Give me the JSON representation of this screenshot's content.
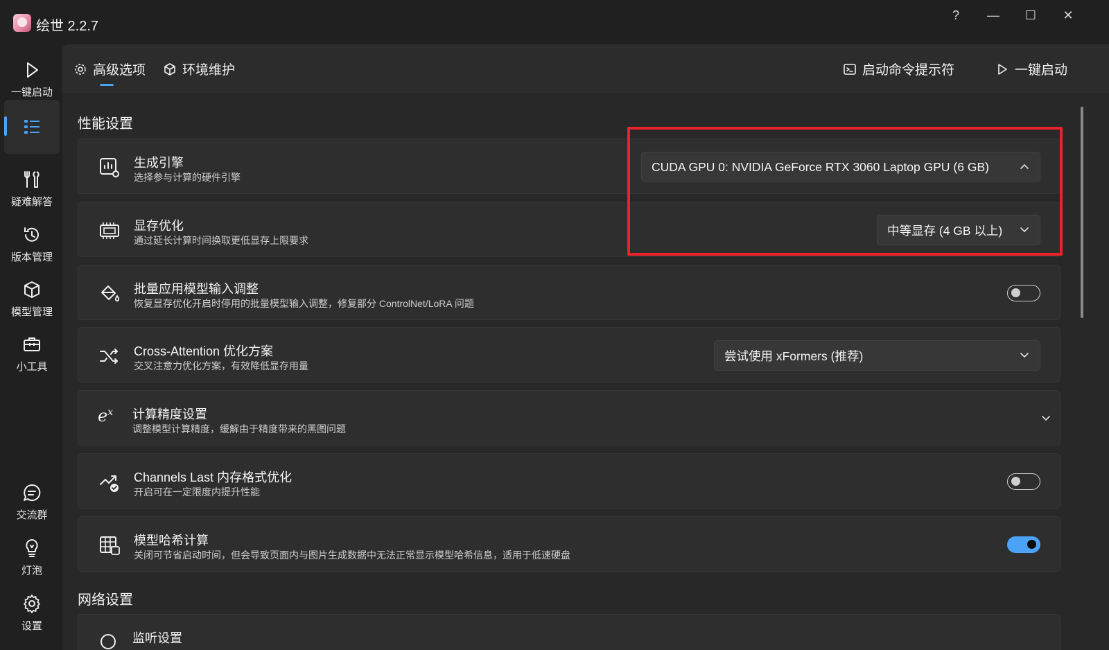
{
  "window": {
    "title": "绘世 2.2.7",
    "help_glyph": "?",
    "minimize_glyph": "—",
    "maximize_glyph": "☐",
    "close_glyph": "✕"
  },
  "nav": {
    "top": [
      {
        "label": "一键启动",
        "icon": "play-icon"
      },
      {
        "label": "",
        "icon": "list-icon"
      },
      {
        "label": "疑难解答",
        "icon": "tools-icon"
      },
      {
        "label": "版本管理",
        "icon": "history-icon"
      },
      {
        "label": "模型管理",
        "icon": "cube-icon"
      },
      {
        "label": "小工具",
        "icon": "toolbox-icon"
      }
    ],
    "bottom": [
      {
        "label": "交流群",
        "icon": "chat-icon"
      },
      {
        "label": "灯泡",
        "icon": "lightbulb-icon"
      },
      {
        "label": "设置",
        "icon": "gear-icon"
      }
    ],
    "accent": "#4aa3f5"
  },
  "tabs": {
    "advanced": "高级选项",
    "env": "环境维护",
    "cmd": "启动命令提示符",
    "launch": "一键启动"
  },
  "sections": {
    "performance": "性能设置",
    "network": "网络设置"
  },
  "settings": [
    {
      "title": "生成引擎",
      "desc": "选择参与计算的硬件引擎",
      "value": "CUDA GPU 0: NVIDIA GeForce RTX 3060 Laptop GPU (6 GB)",
      "icon": "engine-icon"
    },
    {
      "title": "显存优化",
      "desc": "通过延长计算时间换取更低显存上限要求",
      "value": "中等显存 (4 GB 以上)",
      "icon": "memory-icon"
    },
    {
      "title": "批量应用模型输入调整",
      "desc": "恢复显存优化开启时停用的批量模型输入调整，修复部分 ControlNet/LoRA 问题",
      "toggle": false,
      "icon": "paint-bucket-icon"
    },
    {
      "title": "Cross-Attention 优化方案",
      "desc": "交叉注意力优化方案，有效降低显存用量",
      "value": "尝试使用 xFormers (推荐)",
      "icon": "shuffle-icon"
    },
    {
      "title": "计算精度设置",
      "desc": "调整模型计算精度，缓解由于精度带来的黑图问题",
      "icon": "exponent-icon",
      "exp_glyph": "e",
      "exp_sup": "x"
    },
    {
      "title": "Channels Last 内存格式优化",
      "desc": "开启可在一定限度内提升性能",
      "toggle": false,
      "icon": "chart-check-icon"
    },
    {
      "title": "模型哈希计算",
      "desc": "关闭可节省启动时间，但会导致页面内与图片生成数据中无法正常显示模型哈希信息，适用于低速硬盘",
      "toggle": true,
      "icon": "hash-table-icon"
    },
    {
      "title": "监听设置",
      "icon": "network-icon"
    }
  ],
  "colors": {
    "highlight_box": "#e8232a",
    "toggle_on": "#4aa3f5"
  }
}
